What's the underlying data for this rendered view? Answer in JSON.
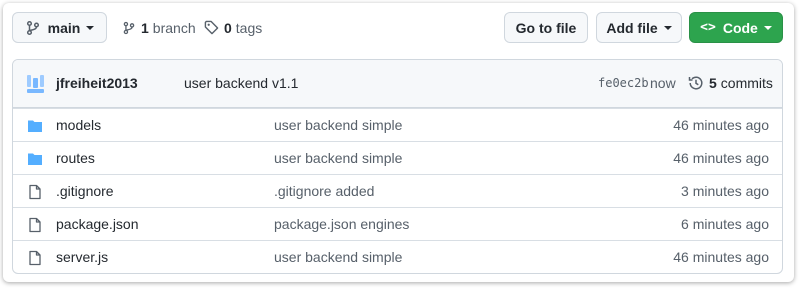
{
  "toolbar": {
    "branch_name": "main",
    "branch_count": "1",
    "branch_word": "branch",
    "tag_count": "0",
    "tag_word": "tags",
    "goto_file_label": "Go to file",
    "add_file_label": "Add file",
    "code_label": "Code",
    "code_color": "#2da44e"
  },
  "commit": {
    "author": "jfreiheit2013",
    "message": "user backend v1.1",
    "hash": "fe0ec2b",
    "time": "now",
    "commit_count": "5",
    "commit_word": "commits"
  },
  "files": [
    {
      "type": "folder",
      "icon": "folder-icon",
      "name": "models",
      "message": "user backend simple",
      "age": "46 minutes ago"
    },
    {
      "type": "folder",
      "icon": "folder-icon",
      "name": "routes",
      "message": "user backend simple",
      "age": "46 minutes ago"
    },
    {
      "type": "file",
      "icon": "file-icon",
      "name": ".gitignore",
      "message": ".gitignore added",
      "age": "3 minutes ago"
    },
    {
      "type": "file",
      "icon": "file-icon",
      "name": "package.json",
      "message": "package.json engines",
      "age": "6 minutes ago"
    },
    {
      "type": "file",
      "icon": "file-icon",
      "name": "server.js",
      "message": "user backend simple",
      "age": "46 minutes ago"
    }
  ]
}
